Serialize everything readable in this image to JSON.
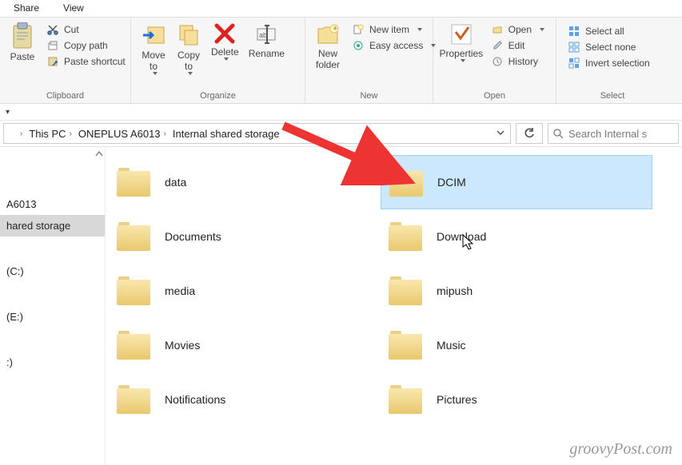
{
  "tabs": {
    "share": "Share",
    "view": "View"
  },
  "ribbon": {
    "clipboard": {
      "label": "Clipboard",
      "paste": "Paste",
      "cut": "Cut",
      "copyPath": "Copy path",
      "pasteShortcut": "Paste shortcut"
    },
    "organize": {
      "label": "Organize",
      "moveTo": "Move\nto",
      "copyTo": "Copy\nto",
      "delete": "Delete",
      "rename": "Rename"
    },
    "new": {
      "label": "New",
      "newFolder": "New\nfolder",
      "newItem": "New item",
      "easyAccess": "Easy access"
    },
    "open": {
      "label": "Open",
      "properties": "Properties",
      "open": "Open",
      "edit": "Edit",
      "history": "History"
    },
    "select": {
      "label": "Select",
      "all": "Select all",
      "none": "Select none",
      "invert": "Invert selection"
    }
  },
  "breadcrumbs": [
    "This PC",
    "ONEPLUS A6013",
    "Internal shared storage"
  ],
  "search": {
    "placeholder": "Search Internal s"
  },
  "sidebar": {
    "items": [
      "A6013",
      "hared storage",
      "(C:)",
      "(E:)",
      ":)"
    ],
    "selected": 1
  },
  "folders": {
    "col1": [
      "data",
      "Documents",
      "media",
      "Movies",
      "Notifications"
    ],
    "col2": [
      "DCIM",
      "Download",
      "mipush",
      "Music",
      "Pictures"
    ],
    "selectedCol2": 0
  },
  "watermark": "groovyPost.com"
}
